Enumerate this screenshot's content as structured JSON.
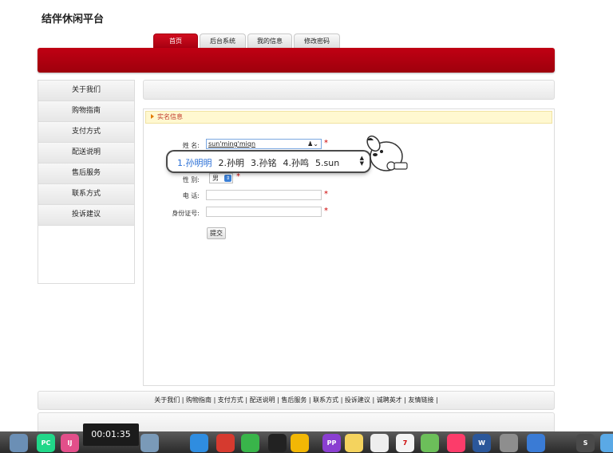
{
  "site": {
    "title": "结伴休闲平台"
  },
  "tabs": [
    {
      "label": "首页",
      "active": true
    },
    {
      "label": "后台系统"
    },
    {
      "label": "我的信息"
    },
    {
      "label": "修改密码"
    }
  ],
  "sidebar": {
    "items": [
      {
        "label": "关于我们"
      },
      {
        "label": "购物指南"
      },
      {
        "label": "支付方式"
      },
      {
        "label": "配送说明"
      },
      {
        "label": "售后服务"
      },
      {
        "label": "联系方式"
      },
      {
        "label": "投诉建议"
      }
    ]
  },
  "form": {
    "section_title": "实名信息",
    "name_label": "姓 名:",
    "name_value": "sun'ming'miqn",
    "gender_label": "性 别:",
    "gender_value": "男",
    "phone_label": "电 话:",
    "id_label": "身份证号:",
    "required_mark": "*",
    "submit_label": "提交"
  },
  "ime": {
    "candidates": [
      "1.孙明明",
      "2.孙明",
      "3.孙铭",
      "4.孙鸣",
      "5.sun"
    ]
  },
  "footer": {
    "links": "关于我们 | 购物指南 | 支付方式 | 配送说明 | 售后服务 | 联系方式 | 投诉建议 | 诚聘英才 | 友情链接 |"
  },
  "video": {
    "timestamp": "00:01:35"
  },
  "dock": {
    "icons": [
      {
        "name": "launchpad-icon",
        "label": "",
        "color": "#6b8fb5"
      },
      {
        "name": "pycharm-icon",
        "label": "PC",
        "color": "#21d789"
      },
      {
        "name": "intellij-icon",
        "label": "IJ",
        "color": "#e24f8a"
      },
      {
        "name": "database-icon",
        "label": "",
        "color": "#7a9ab8"
      },
      {
        "name": "safari-icon",
        "label": "",
        "color": "#2f8de0"
      },
      {
        "name": "redis-icon",
        "label": "",
        "color": "#d63a2f"
      },
      {
        "name": "wechat-icon",
        "label": "",
        "color": "#39b54a"
      },
      {
        "name": "qq-icon",
        "label": "",
        "color": "#222222"
      },
      {
        "name": "sync-icon",
        "label": "",
        "color": "#f2b705"
      },
      {
        "name": "phpstorm-icon",
        "label": "PP",
        "color": "#8a3fd1"
      },
      {
        "name": "notes-icon",
        "label": "",
        "color": "#f4d35e"
      },
      {
        "name": "textedit-icon",
        "label": "",
        "color": "#eeeeee"
      },
      {
        "name": "calendar-icon",
        "label": "7",
        "color": "#f4f4f4"
      },
      {
        "name": "maps-icon",
        "label": "",
        "color": "#6cbf5a"
      },
      {
        "name": "music-icon",
        "label": "",
        "color": "#fc3c6a"
      },
      {
        "name": "word-icon",
        "label": "W",
        "color": "#2b579a"
      },
      {
        "name": "system-preferences-icon",
        "label": "",
        "color": "#8e8e8e"
      },
      {
        "name": "baidu-netdisk-icon",
        "label": "",
        "color": "#3a7bd5"
      },
      {
        "name": "sublime-icon",
        "label": "S",
        "color": "#4a4a4a"
      },
      {
        "name": "finder-icon",
        "label": "",
        "color": "#5aa9e6"
      }
    ]
  }
}
